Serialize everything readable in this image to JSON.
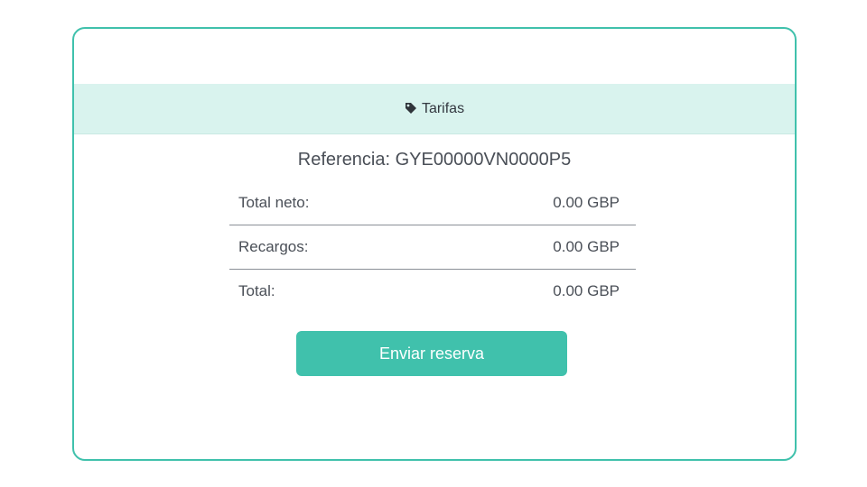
{
  "header": {
    "icon": "tag-icon",
    "title": "Tarifas"
  },
  "reference": {
    "text": "Referencia: GYE00000VN0000P5"
  },
  "summary": {
    "rows": [
      {
        "label": "Total neto:",
        "value": "0.00 GBP"
      },
      {
        "label": "Recargos:",
        "value": "0.00 GBP"
      },
      {
        "label": "Total:",
        "value": "0.00 GBP"
      }
    ]
  },
  "actions": {
    "submit_label": "Enviar reserva"
  },
  "colors": {
    "accent": "#40c1ac",
    "header_bg": "#d9f3ee",
    "text": "#4a4f57"
  }
}
